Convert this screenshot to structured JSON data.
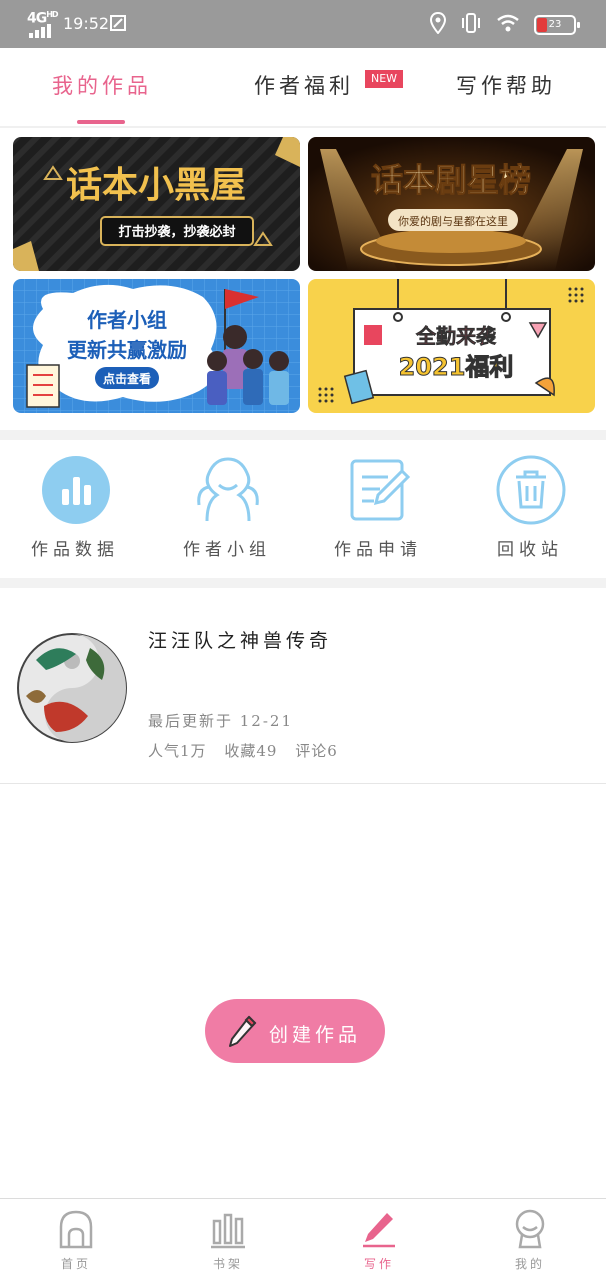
{
  "status_bar": {
    "network": "4G",
    "network_sup": "HD",
    "time": "19:52",
    "battery": "23"
  },
  "top_tabs": [
    {
      "label": "我的作品",
      "active": true
    },
    {
      "label": "作者福利",
      "active": false,
      "badge": "NEW"
    },
    {
      "label": "写作帮助",
      "active": false
    }
  ],
  "banners": [
    {
      "title": "话本小黑屋",
      "subtitle": "打击抄袭，抄袭必封"
    },
    {
      "title": "话本剧星榜",
      "subtitle": "你爱的剧与星都在这里"
    },
    {
      "title_line1": "作者小组",
      "title_line2": "更新共赢激励",
      "button": "点击查看"
    },
    {
      "title_line1": "全勤来袭",
      "title_line2": "2021福利"
    }
  ],
  "quick_actions": [
    {
      "label": "作品数据",
      "icon": "bar-chart-icon"
    },
    {
      "label": "作者小组",
      "icon": "group-icon"
    },
    {
      "label": "作品申请",
      "icon": "edit-document-icon"
    },
    {
      "label": "回收站",
      "icon": "trash-icon"
    }
  ],
  "work": {
    "title": "汪汪队之神兽传奇",
    "updated": "最后更新于 12-21",
    "popularity": "人气1万",
    "favorites": "收藏49",
    "comments": "评论6"
  },
  "create_button": {
    "label": "创建作品"
  },
  "bottom_nav": [
    {
      "label": "首页",
      "icon": "home-icon",
      "active": false
    },
    {
      "label": "书架",
      "icon": "bookshelf-icon",
      "active": false
    },
    {
      "label": "写作",
      "icon": "pencil-icon",
      "active": true
    },
    {
      "label": "我的",
      "icon": "profile-icon",
      "active": false
    }
  ],
  "colors": {
    "accent": "#e8648d",
    "create_button": "#f07ca5",
    "icon_blue": "#8ecdf0",
    "status_bar": "#9a9a9a"
  }
}
